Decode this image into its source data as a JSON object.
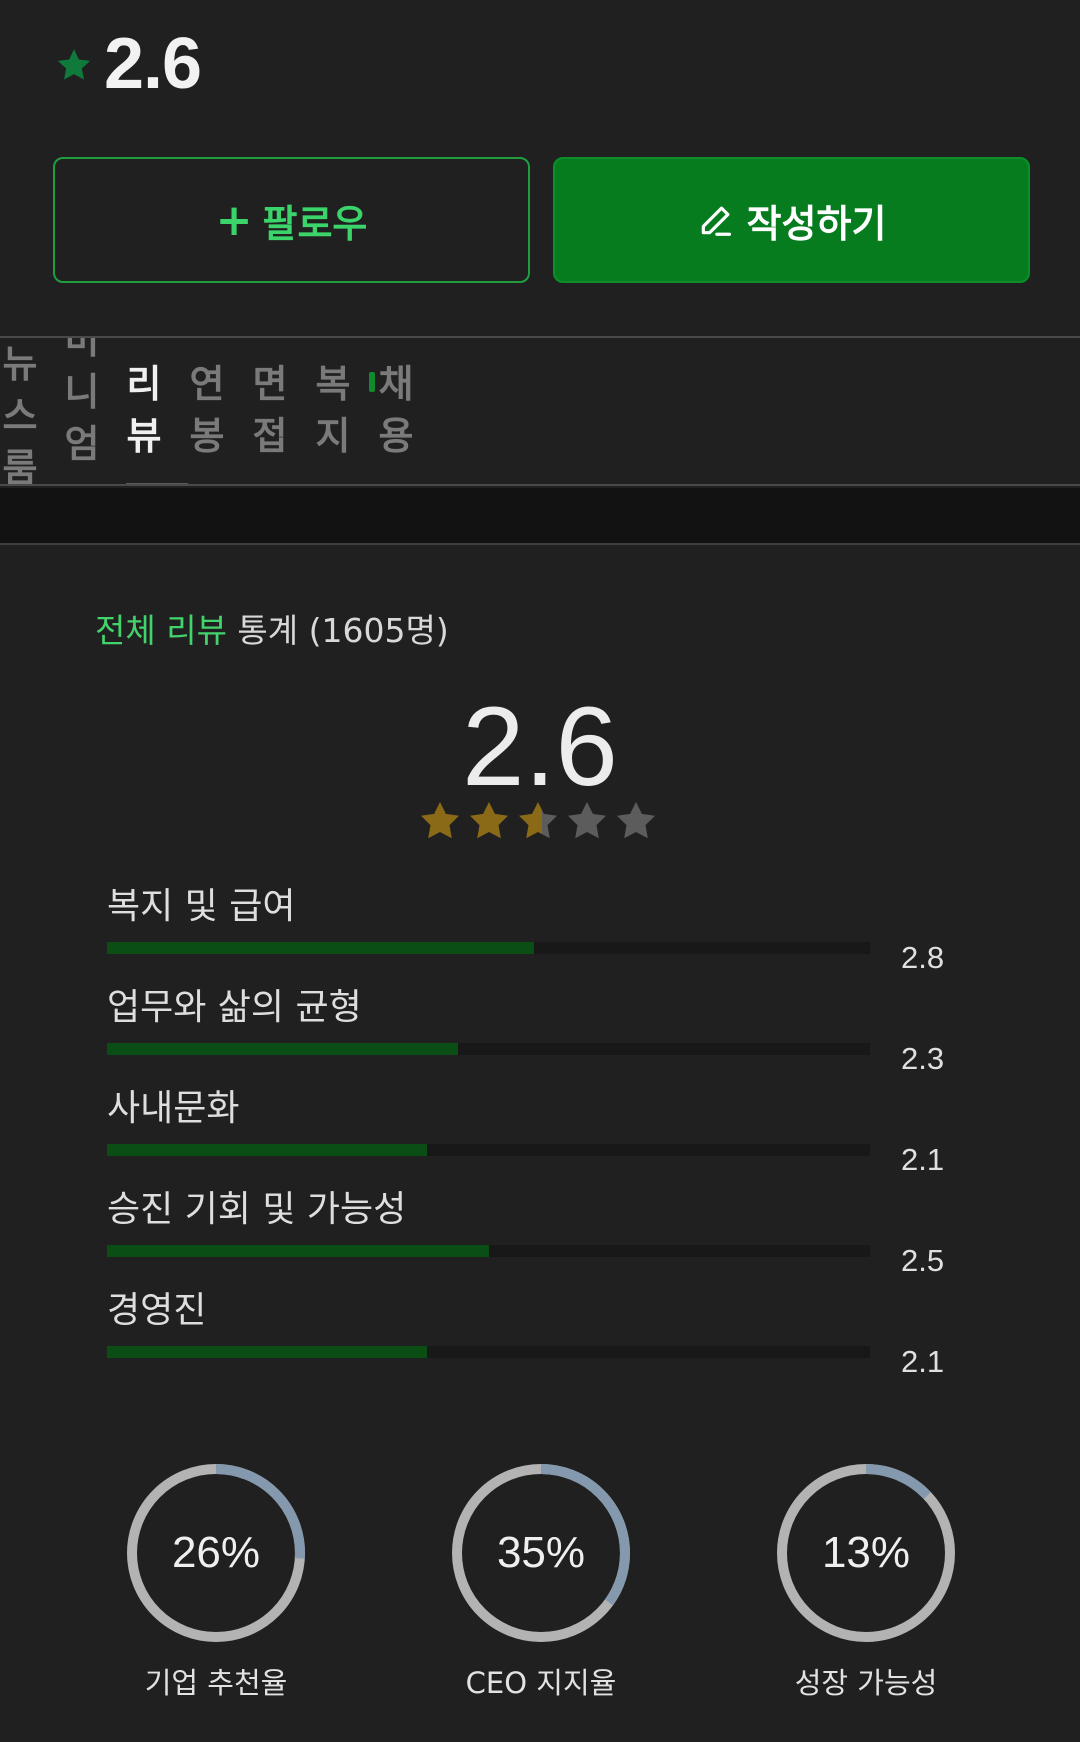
{
  "header": {
    "rating": "2.6"
  },
  "actions": {
    "follow_label": "팔로우",
    "write_label": "작성하기"
  },
  "tabs": [
    {
      "label": "뉴스룸"
    },
    {
      "label": "미니엄"
    },
    {
      "label": "리뷰",
      "active": true
    },
    {
      "label": "연봉"
    },
    {
      "label": "면접"
    },
    {
      "label": "복지"
    },
    {
      "label": "채용"
    }
  ],
  "stats": {
    "title_accent": "전체 리뷰",
    "title_rest": " 통계 (1605명)",
    "overall": "2.6",
    "overall_value": 2.6,
    "star_colors": {
      "filled": "#8a6a16",
      "empty": "#5c5c5c"
    },
    "categories": [
      {
        "label": "복지 및 급여",
        "score": "2.8",
        "value": 2.8
      },
      {
        "label": "업무와 삶의 균형",
        "score": "2.3",
        "value": 2.3
      },
      {
        "label": "사내문화",
        "score": "2.1",
        "value": 2.1
      },
      {
        "label": "승진 기회 및 가능성",
        "score": "2.5",
        "value": 2.5
      },
      {
        "label": "경영진",
        "score": "2.1",
        "value": 2.1
      }
    ]
  },
  "donuts": [
    {
      "pct_label": "26%",
      "value": 26,
      "label": "기업 추천율"
    },
    {
      "pct_label": "35%",
      "value": 35,
      "label": "CEO 지지율"
    },
    {
      "pct_label": "13%",
      "value": 13,
      "label": "성장 가능성"
    }
  ],
  "colors": {
    "accent_green": "#43d36d",
    "button_green": "#067c1f",
    "bar_fill": "#0a4d15",
    "donut_track": "#b3b3b3",
    "donut_fill": "#8499ad"
  }
}
